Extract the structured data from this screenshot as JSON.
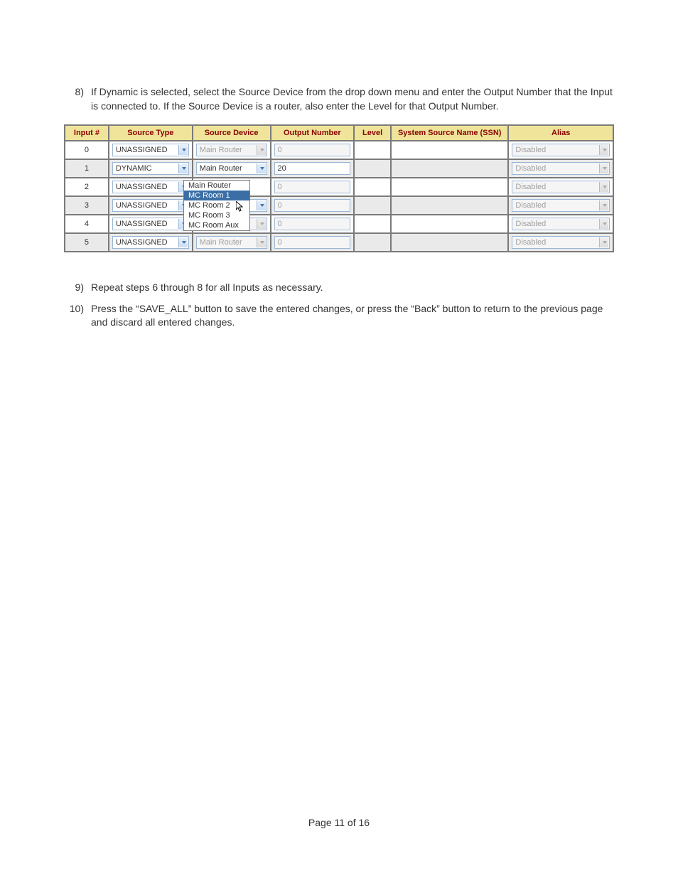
{
  "steps": {
    "s8": {
      "num": "8)",
      "text": "If Dynamic is selected, select the Source Device from the drop down menu and enter the Output Number that the Input is connected to. If the Source Device is a router, also enter the Level for that Output Number."
    },
    "s9": {
      "num": "9)",
      "text": "Repeat steps 6 through 8 for all Inputs as necessary."
    },
    "s10": {
      "num": "10)",
      "text": "Press the “SAVE_ALL” button to save the entered changes, or press the “Back” button to return to the previous page and discard all entered changes."
    }
  },
  "headers": {
    "input": "Input #",
    "stype": "Source Type",
    "sdev": "Source Device",
    "onum": "Output Number",
    "level": "Level",
    "ssn": "System Source Name (SSN)",
    "alias": "Alias"
  },
  "rows": [
    {
      "input": "0",
      "stype": "UNASSIGNED",
      "stype_interactable": true,
      "sdev": "Main Router",
      "sdev_disabled": true,
      "onum": "0",
      "onum_disabled": true,
      "level": "",
      "ssn": "",
      "alias": "Disabled",
      "alias_disabled": true
    },
    {
      "input": "1",
      "stype": "DYNAMIC",
      "stype_interactable": true,
      "sdev": "Main Router",
      "sdev_disabled": false,
      "onum": "20",
      "onum_disabled": false,
      "level": "",
      "ssn": "",
      "alias": "Disabled",
      "alias_disabled": true,
      "alt": true
    },
    {
      "input": "2",
      "stype": "UNASSIGNED",
      "stype_interactable": true,
      "sdev": "",
      "sdev_dropdown": true,
      "onum": "0",
      "onum_disabled": true,
      "level": "",
      "ssn": "",
      "alias": "Disabled",
      "alias_disabled": true
    },
    {
      "input": "3",
      "stype": "UNASSIGNED",
      "stype_interactable": true,
      "sdev": "",
      "onum": "0",
      "onum_disabled": true,
      "level": "",
      "ssn": "",
      "alias": "Disabled",
      "alias_disabled": true,
      "alt": true
    },
    {
      "input": "4",
      "stype": "UNASSIGNED",
      "stype_interactable": true,
      "sdev": "Main Router",
      "sdev_disabled": true,
      "onum": "0",
      "onum_disabled": true,
      "level": "",
      "ssn": "",
      "alias": "Disabled",
      "alias_disabled": true
    },
    {
      "input": "5",
      "stype": "UNASSIGNED",
      "stype_interactable": true,
      "sdev": "Main Router",
      "sdev_disabled": true,
      "onum": "0",
      "onum_disabled": true,
      "level": "",
      "ssn": "",
      "alias": "Disabled",
      "alias_disabled": true,
      "alt": true,
      "cut": true
    }
  ],
  "dropdown": {
    "options": [
      "Main Router",
      "MC Room 1",
      "MC Room 2",
      "MC Room 3",
      "MC Room Aux"
    ],
    "selected": "MC Room 1"
  },
  "footer": "Page 11 of 16"
}
